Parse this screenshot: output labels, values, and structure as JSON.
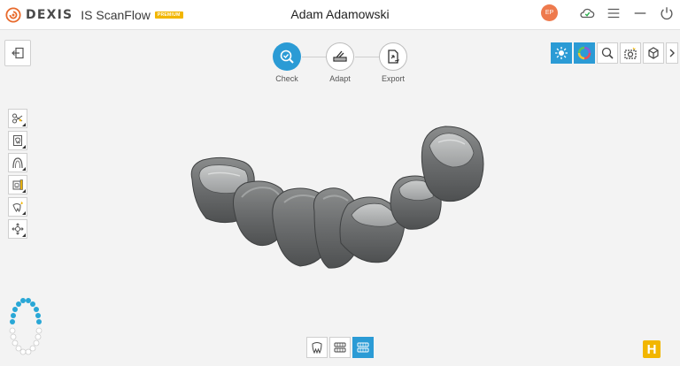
{
  "header": {
    "brand": "DEXIS",
    "product": "IS ScanFlow",
    "badge": "PREMIUM",
    "patient_name": "Adam Adamowski",
    "user_initials": "EP"
  },
  "workflow": {
    "steps": [
      {
        "label": "Check",
        "icon": "check-scan-icon",
        "active": true
      },
      {
        "label": "Adapt",
        "icon": "adapt-icon",
        "active": false
      },
      {
        "label": "Export",
        "icon": "export-icon",
        "active": false
      }
    ]
  },
  "right_toolbar": [
    {
      "icon": "brightness-icon",
      "active": true
    },
    {
      "icon": "color-wheel-icon",
      "active": true
    },
    {
      "icon": "zoom-icon",
      "active": false
    },
    {
      "icon": "snapshot-icon",
      "active": false
    },
    {
      "icon": "3d-view-icon",
      "active": false
    },
    {
      "icon": "chevron-right-icon",
      "active": false
    }
  ],
  "left_toolbar": [
    {
      "icon": "trim-icon"
    },
    {
      "icon": "tooth-select-icon"
    },
    {
      "icon": "arch-icon"
    },
    {
      "icon": "scan-body-icon"
    },
    {
      "icon": "tooth-edit-icon"
    },
    {
      "icon": "move-icon"
    }
  ],
  "view_selector": [
    {
      "icon": "lower-jaw-view-icon",
      "active": false
    },
    {
      "icon": "bite-view-icon",
      "active": false
    },
    {
      "icon": "occlusion-view-icon",
      "active": true
    }
  ],
  "help_label": "H",
  "colors": {
    "accent": "#2b9bd5",
    "avatar": "#ee7a4d",
    "help": "#f2b600",
    "teeth_highlight": "#29a7d6"
  }
}
